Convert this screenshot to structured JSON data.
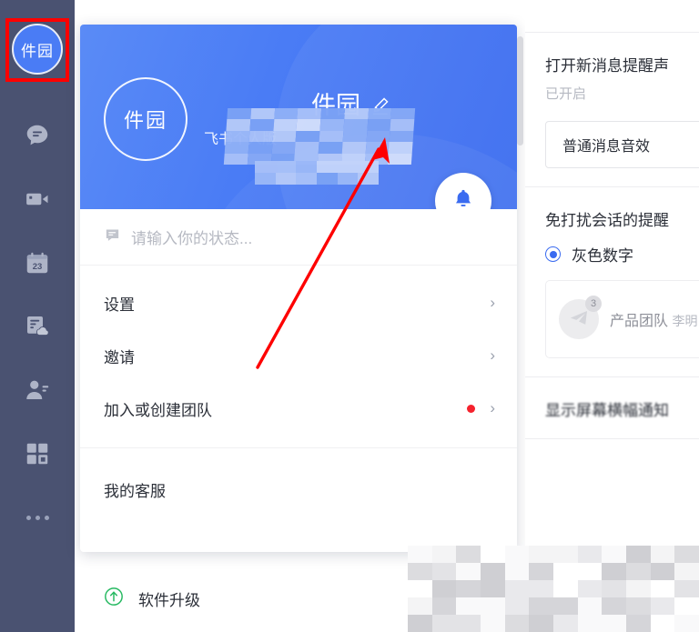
{
  "colors": {
    "rail_bg": "#4a5271",
    "brand_blue": "#4a7cf5",
    "header_gradient_from": "#5a8bf6",
    "header_gradient_to": "#3a6bf0",
    "accent_red": "#fe0000",
    "badge_red": "#f5222d",
    "upgrade_green": "#26b961",
    "radio_blue": "#3a6bf0"
  },
  "rail": {
    "avatar_label": "件园",
    "items": [
      {
        "name": "chat-icon",
        "label": "消息"
      },
      {
        "name": "video-icon",
        "label": "视频会议"
      },
      {
        "name": "calendar-icon",
        "label": "日历",
        "day": "23"
      },
      {
        "name": "docs-cloud-icon",
        "label": "云文档"
      },
      {
        "name": "contacts-icon",
        "label": "通讯录"
      },
      {
        "name": "apps-grid-icon",
        "label": "工作台"
      },
      {
        "name": "more-dots-icon",
        "label": "更多"
      }
    ]
  },
  "profile": {
    "avatar_label": "件园",
    "name": "件园",
    "name_redacted": true,
    "subtitle": "飞书个人版",
    "subtitle_redacted": true,
    "edit_icon": "pencil-icon",
    "bell_icon": "bell-icon",
    "status_placeholder": "请输入你的状态...",
    "status_icon": "speech-bubble-icon"
  },
  "menu": {
    "group_one": [
      {
        "label": "设置",
        "badge": false,
        "chevron": "›"
      },
      {
        "label": "邀请",
        "badge": false,
        "chevron": "›"
      },
      {
        "label": "加入或创建团队",
        "badge": true,
        "chevron": "›"
      }
    ],
    "group_two": [
      {
        "label": "我的客服",
        "badge": false,
        "chevron": ""
      }
    ]
  },
  "upgrade": {
    "icon": "arrow-up-circle-icon",
    "label": "软件升级"
  },
  "settings_panel": {
    "sound_section": {
      "title": "打开新消息提醒声",
      "status": "已开启",
      "select_value": "普通消息音效"
    },
    "dnd_section": {
      "title": "免打扰会话的提醒",
      "radio_label": "灰色数字",
      "radio_selected": true,
      "preview": {
        "badge": "3",
        "title": "产品团队",
        "message": "李明：大"
      }
    },
    "banner_section": {
      "title": "显示屏幕横幅通知"
    }
  },
  "annotations": {
    "highlight_box": {
      "target": "rail-avatar",
      "color": "#fe0000"
    },
    "arrow": {
      "from_label": "menu-area",
      "to_label": "edit-name-pencil",
      "color": "#fe0000"
    }
  }
}
